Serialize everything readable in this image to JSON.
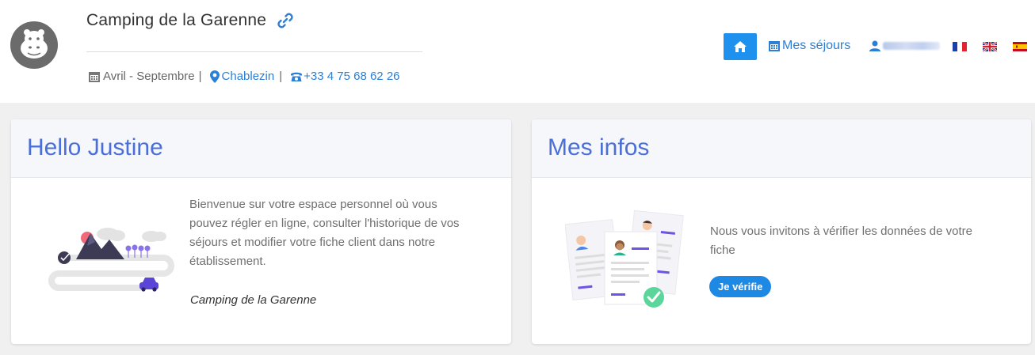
{
  "header": {
    "camping_name": "Camping de la Garenne",
    "period": "Avril - Septembre",
    "location": "Chablezin",
    "phone": "+33 4 75 68 62 26",
    "separator": "|"
  },
  "nav": {
    "home_icon": "home-icon",
    "stays_label": "Mes séjours",
    "user_icon": "user-icon",
    "languages": [
      "fr",
      "en",
      "es"
    ]
  },
  "welcome_card": {
    "title": "Hello Justine",
    "text": "Bienvenue sur votre espace personnel où vous pouvez régler en ligne, consulter l'historique de vos séjours et modifier votre fiche client dans notre établissement.",
    "signature": "Camping de la Garenne"
  },
  "info_card": {
    "title": "Mes infos",
    "text": "Nous vous invitons à vérifier les données de votre fiche",
    "button_label": "Je vérifie"
  },
  "colors": {
    "accent": "#1e88e5",
    "title_blue": "#4b6fd8",
    "link_blue": "#2b7fd6"
  }
}
